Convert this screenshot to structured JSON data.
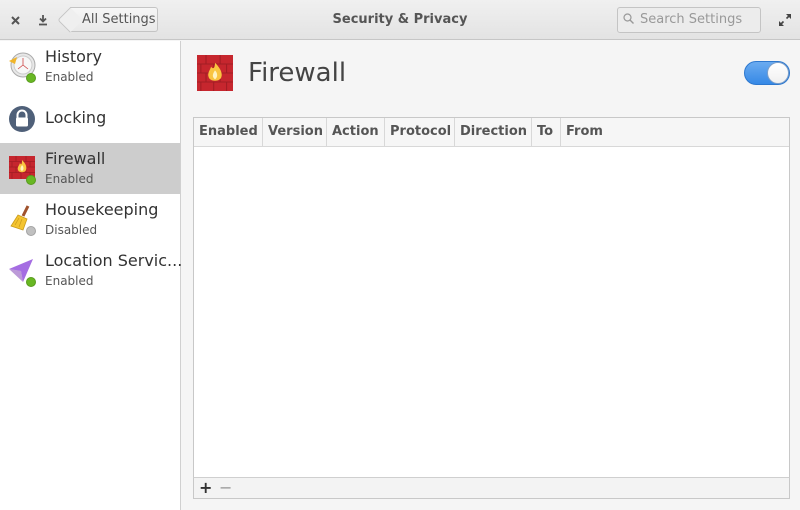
{
  "header": {
    "close_icon": "close-icon",
    "download_icon": "download-icon",
    "back_label": "All Settings",
    "title": "Security & Privacy",
    "search_placeholder": "Search Settings",
    "maximize_icon": "maximize-icon"
  },
  "sidebar": {
    "items": [
      {
        "label": "History",
        "status": "Enabled",
        "status_color": "#68b723",
        "icon": "history-icon"
      },
      {
        "label": "Locking",
        "status": "",
        "icon": "lock-icon"
      },
      {
        "label": "Firewall",
        "status": "Enabled",
        "status_color": "#68b723",
        "icon": "firewall-icon",
        "selected": true
      },
      {
        "label": "Housekeeping",
        "status": "Disabled",
        "status_color": "#c0c0c0",
        "icon": "broom-icon"
      },
      {
        "label": "Location Servic...",
        "status": "Enabled",
        "status_color": "#68b723",
        "icon": "location-icon"
      }
    ]
  },
  "main": {
    "title": "Firewall",
    "toggle_on": true,
    "accent": "#3689e6",
    "table": {
      "columns": [
        "Enabled",
        "Version",
        "Action",
        "Protocol",
        "Direction",
        "To",
        "From"
      ],
      "rows": []
    },
    "toolbar": {
      "add_label": "+",
      "remove_label": "−"
    }
  }
}
